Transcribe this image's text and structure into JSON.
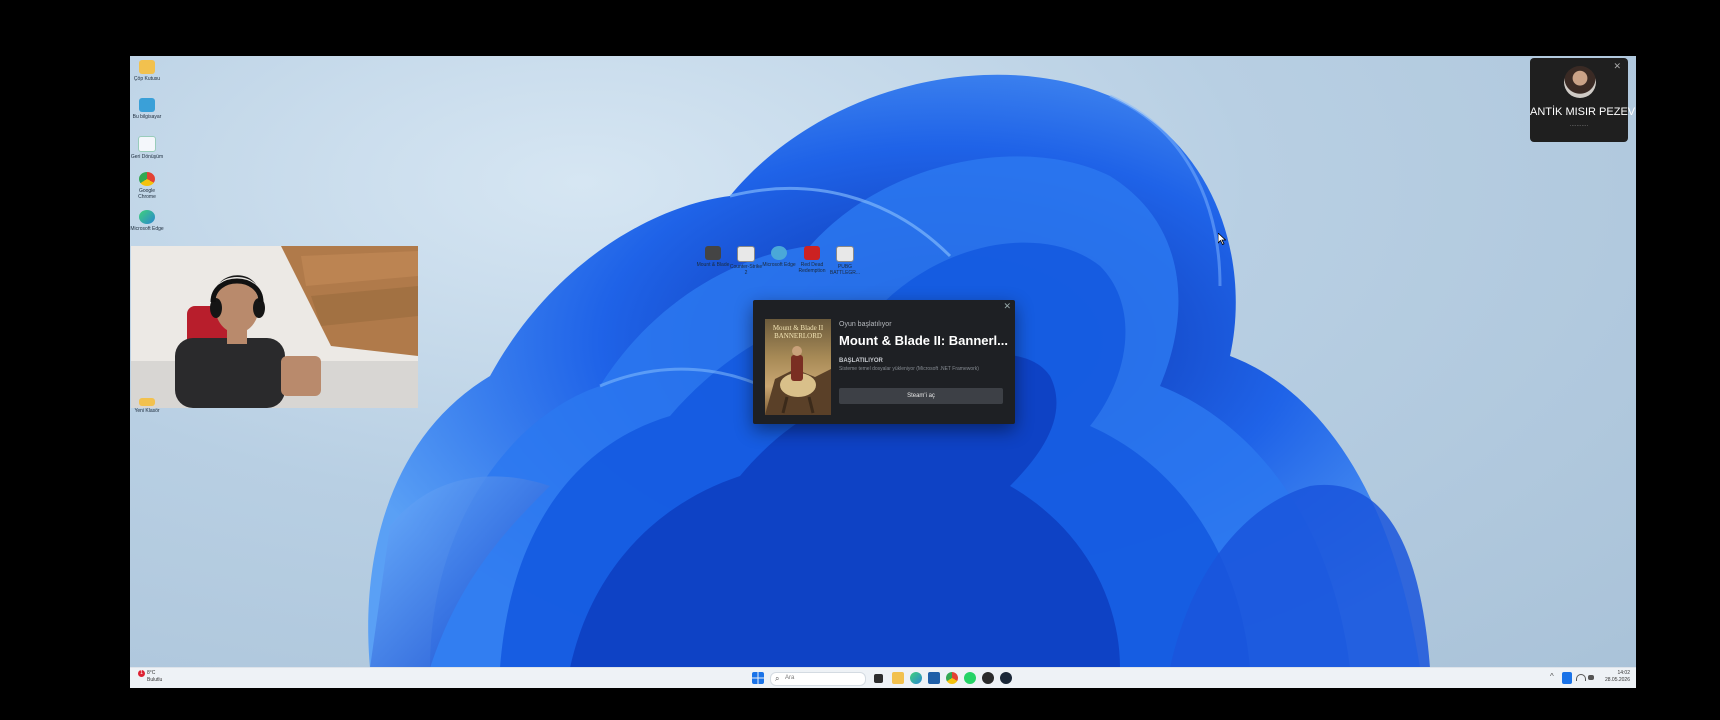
{
  "desktop_icons": [
    {
      "label": "Çöp Kutusu",
      "color": "#f2c14e"
    },
    {
      "label": "Bu bilgisayar",
      "color": "#3aa0d8"
    },
    {
      "label": "Geri Dönüşüm",
      "color": "#ffffff"
    },
    {
      "label": "Google Chrome",
      "color": "#e34234"
    },
    {
      "label": "Microsoft Edge",
      "color": "#2a86d1"
    }
  ],
  "webcam_icon_label": "Yeni Klasör",
  "center_icons": [
    {
      "label": "Mount & Blade",
      "color": "#444"
    },
    {
      "label": "Counter-Strike 2",
      "color": "#e8e8e8"
    },
    {
      "label": "Microsoft Edge",
      "color": "#4aa8d8"
    },
    {
      "label": "Red Dead Redemption",
      "color": "#c22"
    },
    {
      "label": "PUBG BATTLEGR...",
      "color": "#e8e8e8"
    }
  ],
  "call_tile": {
    "name": "ANTİK MISIR PEZEV",
    "dots": "...........",
    "close": "✕"
  },
  "dialog": {
    "subtitle": "Oyun başlatılıyor",
    "title": "Mount & Blade II: Bannerl...",
    "status": "BAŞLATILIYOR",
    "detail": "Sisteme temel dosyalar yükleniyor (Microsoft .NET Framework)",
    "button": "Steam'i aç",
    "cover_title": "Mount & Blade II BANNERLORD",
    "close": "✕"
  },
  "taskbar": {
    "weather_badge": "1",
    "weather_temp": "8°C",
    "weather_text": "Bulutlu",
    "search_placeholder": "Ara",
    "time": "14:02",
    "date": "28.05.2026",
    "app_icons": [
      "task-view",
      "file-explorer",
      "edge",
      "store",
      "chrome",
      "whatsapp",
      "settings",
      "steam"
    ]
  },
  "colors": {
    "dialog_bg": "#1e2024",
    "button_bg": "#3d4046",
    "bloom_blue": "#1f63e8"
  }
}
